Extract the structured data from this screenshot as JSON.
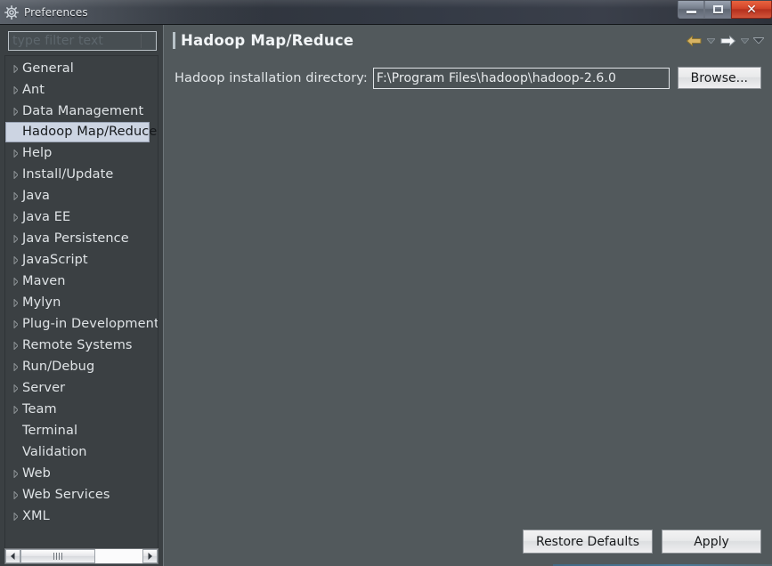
{
  "window": {
    "title": "Preferences",
    "icon": "gear-icon",
    "controls": {
      "minimize": "minimize-icon",
      "maximize": "maximize-icon",
      "close": "✕"
    }
  },
  "sidebar": {
    "filter": {
      "placeholder": "type filter text",
      "value": ""
    },
    "items": [
      {
        "label": "General",
        "expandable": true,
        "selected": false
      },
      {
        "label": "Ant",
        "expandable": true,
        "selected": false
      },
      {
        "label": "Data Management",
        "expandable": true,
        "selected": false
      },
      {
        "label": "Hadoop Map/Reduce",
        "expandable": false,
        "selected": true
      },
      {
        "label": "Help",
        "expandable": true,
        "selected": false
      },
      {
        "label": "Install/Update",
        "expandable": true,
        "selected": false
      },
      {
        "label": "Java",
        "expandable": true,
        "selected": false
      },
      {
        "label": "Java EE",
        "expandable": true,
        "selected": false
      },
      {
        "label": "Java Persistence",
        "expandable": true,
        "selected": false
      },
      {
        "label": "JavaScript",
        "expandable": true,
        "selected": false
      },
      {
        "label": "Maven",
        "expandable": true,
        "selected": false
      },
      {
        "label": "Mylyn",
        "expandable": true,
        "selected": false
      },
      {
        "label": "Plug-in Development",
        "expandable": true,
        "selected": false
      },
      {
        "label": "Remote Systems",
        "expandable": true,
        "selected": false
      },
      {
        "label": "Run/Debug",
        "expandable": true,
        "selected": false
      },
      {
        "label": "Server",
        "expandable": true,
        "selected": false
      },
      {
        "label": "Team",
        "expandable": true,
        "selected": false
      },
      {
        "label": "Terminal",
        "expandable": false,
        "selected": false
      },
      {
        "label": "Validation",
        "expandable": false,
        "selected": false
      },
      {
        "label": "Web",
        "expandable": true,
        "selected": false
      },
      {
        "label": "Web Services",
        "expandable": true,
        "selected": false
      },
      {
        "label": "XML",
        "expandable": true,
        "selected": false
      }
    ],
    "scrollbar": {
      "left_arrow": "◀",
      "right_arrow": "▶"
    }
  },
  "page": {
    "title": "Hadoop Map/Reduce",
    "nav": {
      "back": "back-arrow-icon",
      "back_menu": "chevron-down-icon",
      "forward": "forward-arrow-icon",
      "forward_menu": "chevron-down-icon",
      "view_menu": "chevron-down-icon"
    },
    "form": {
      "install_dir_label": "Hadoop installation directory:",
      "install_dir_value": "F:\\Program Files\\hadoop\\hadoop-2.6.0",
      "install_dir_placeholder": "",
      "browse_label": "Browse..."
    },
    "footer": {
      "restore_defaults_label": "Restore Defaults",
      "apply_label": "Apply"
    }
  },
  "colors": {
    "accent_selection": "#ccd4e2",
    "close_button": "#c8381f",
    "back_arrow": "#d8b464",
    "content_bg": "#52595c",
    "sidebar_bg": "#3b4043"
  }
}
